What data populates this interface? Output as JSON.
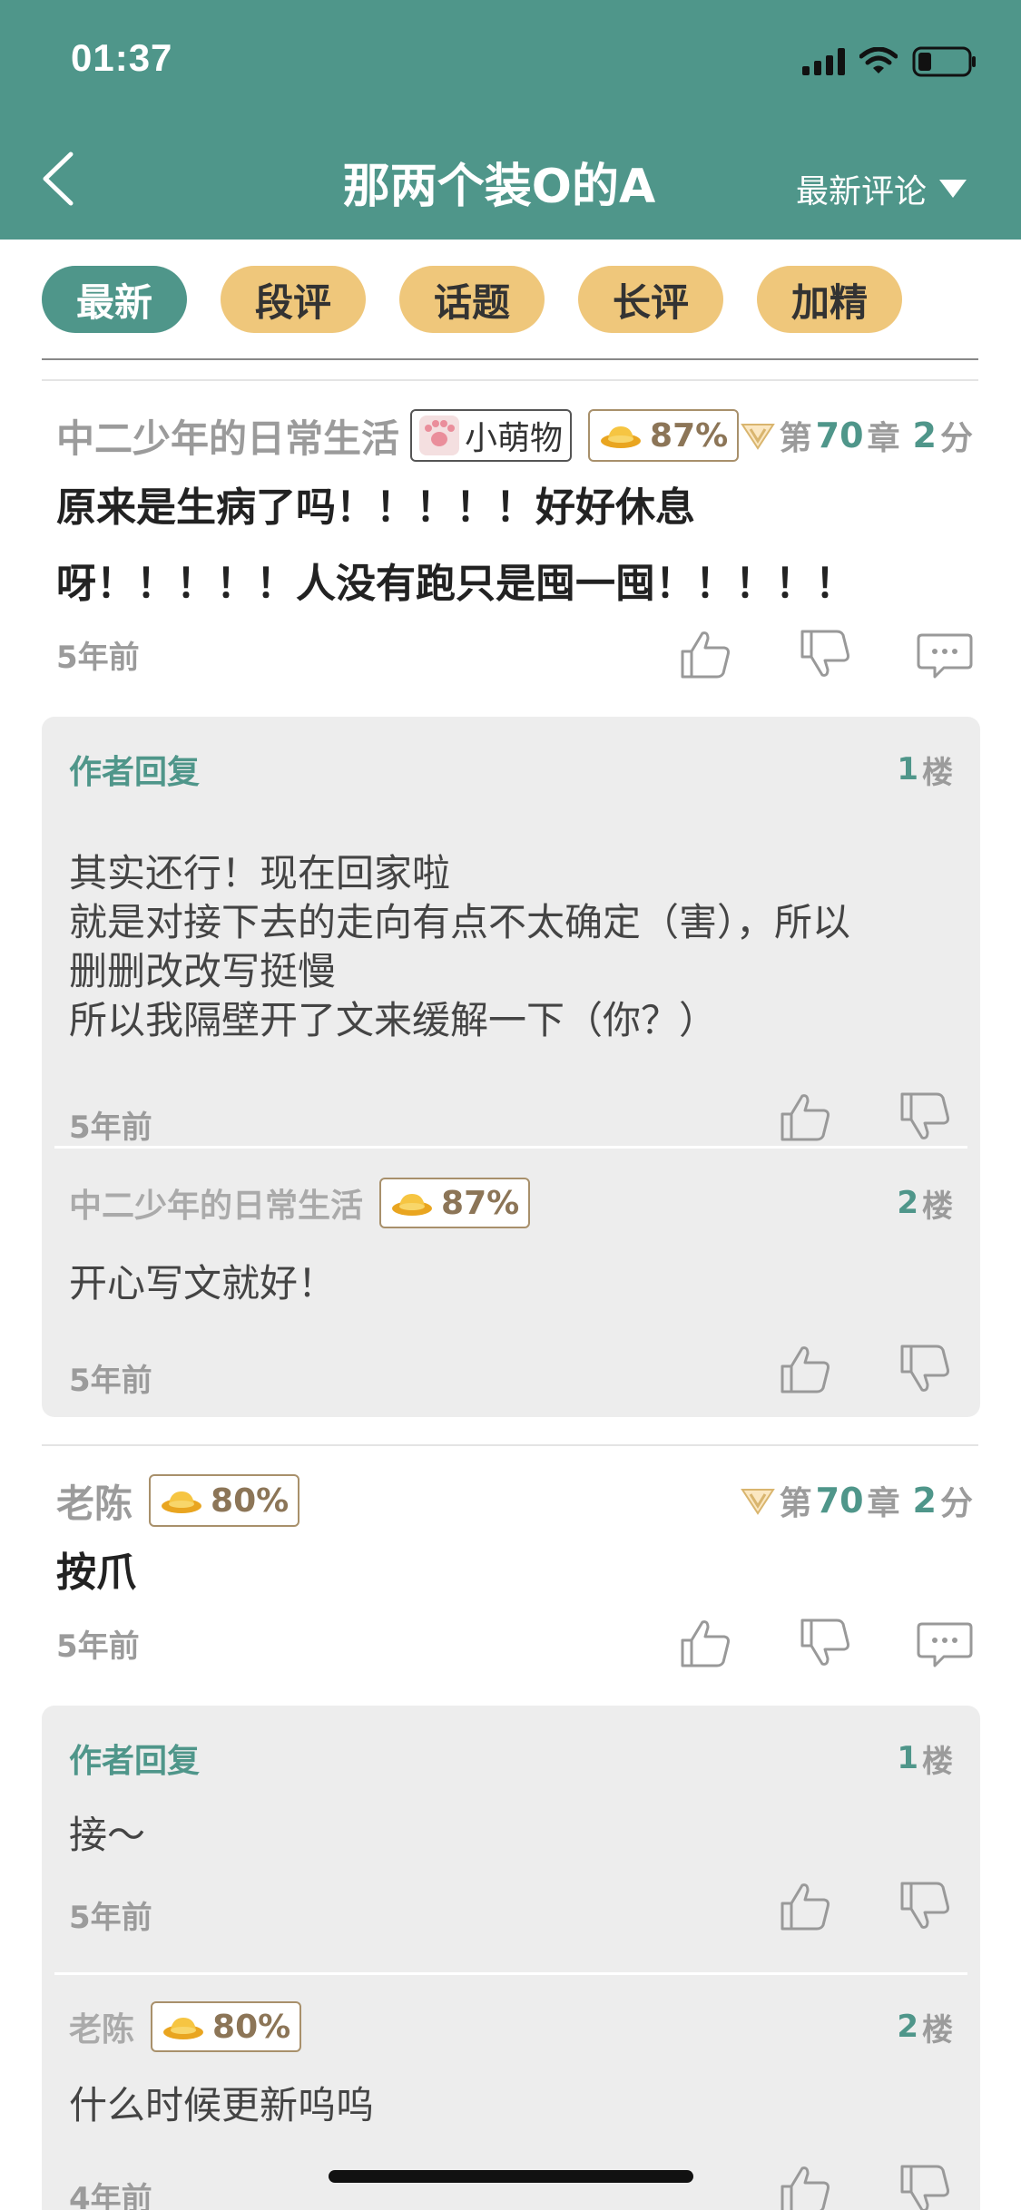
{
  "status_bar": {
    "time": "01:37"
  },
  "header": {
    "title": "那两个装O的A",
    "sort_label": "最新评论"
  },
  "tabs": [
    {
      "label": "最新",
      "active": true
    },
    {
      "label": "段评",
      "active": false
    },
    {
      "label": "话题",
      "active": false
    },
    {
      "label": "长评",
      "active": false
    },
    {
      "label": "加精",
      "active": false
    }
  ],
  "comments": [
    {
      "user": "中二少年的日常生活",
      "badge_tag": "小萌物",
      "gold_percent": "87%",
      "chapter_prefix": "第",
      "chapter_num": "70",
      "chapter_mid": "章",
      "score_num": "2",
      "score_unit": "分",
      "body_line1": "原来是生病了吗！！！！！好好休息",
      "body_line2": "呀！！！！！人没有跑只是囤一囤！！！！！",
      "time": "5年前",
      "replies": [
        {
          "user": "作者回复",
          "floor_num": "1",
          "floor_unit": "楼",
          "lines": [
            "其实还行！现在回家啦",
            "就是对接下去的走向有点不太确定（害），所以",
            "删删改改写挺慢",
            "所以我隔壁开了文来缓解一下（你？）"
          ],
          "time": "5年前"
        },
        {
          "user": "中二少年的日常生活",
          "gold_percent": "87%",
          "floor_num": "2",
          "floor_unit": "楼",
          "body": "开心写文就好！",
          "time": "5年前"
        }
      ]
    },
    {
      "user": "老陈",
      "gold_percent": "80%",
      "chapter_prefix": "第",
      "chapter_num": "70",
      "chapter_mid": "章",
      "score_num": "2",
      "score_unit": "分",
      "body": "按爪",
      "time": "5年前",
      "replies": [
        {
          "user": "作者回复",
          "floor_num": "1",
          "floor_unit": "楼",
          "body": "接～",
          "time": "5年前"
        },
        {
          "user": "老陈",
          "gold_percent": "80%",
          "floor_num": "2",
          "floor_unit": "楼",
          "body": "什么时候更新呜呜",
          "time": "4年前"
        }
      ]
    }
  ],
  "colors": {
    "accent": "#4f968a",
    "tab": "#efc77b",
    "reply_bg": "#ededed"
  },
  "icons": [
    "back-icon",
    "signal-icon",
    "wifi-icon",
    "battery-icon",
    "dropdown-triangle-icon",
    "thumbs-up-icon",
    "thumbs-down-icon",
    "reply-bubble-icon",
    "gold-ingot-icon",
    "vip-v-icon",
    "paw-icon"
  ]
}
